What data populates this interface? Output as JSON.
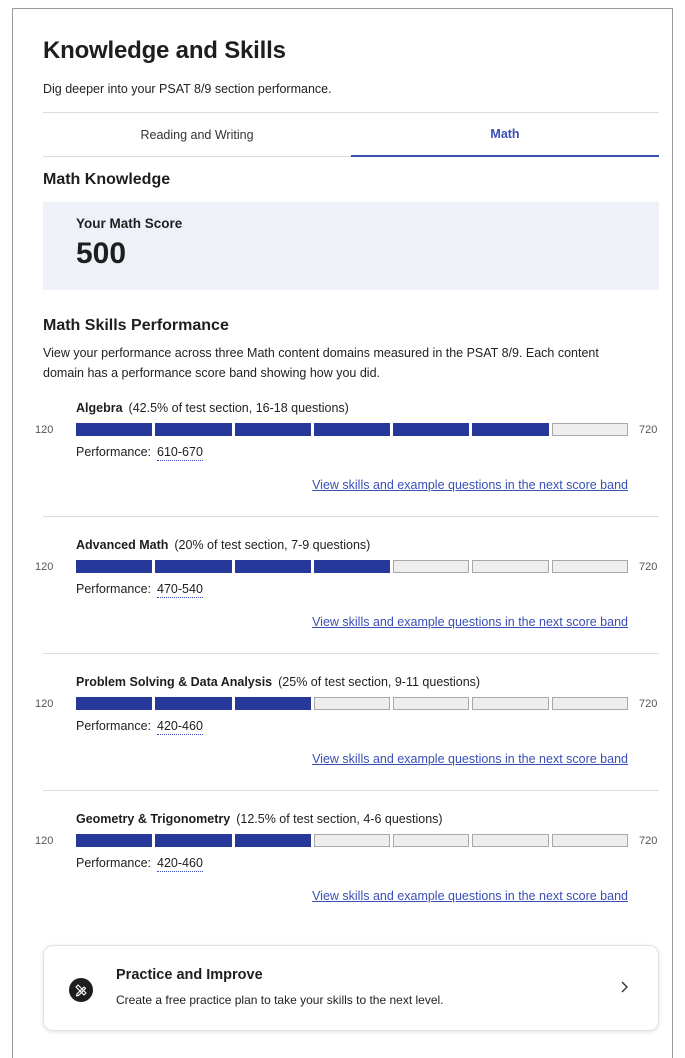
{
  "header": {
    "title": "Knowledge and Skills",
    "subtitle": "Dig deeper into your PSAT 8/9 section performance."
  },
  "tabs": [
    {
      "label": "Reading and Writing",
      "active": false
    },
    {
      "label": "Math",
      "active": true
    }
  ],
  "math_knowledge": {
    "heading": "Math Knowledge",
    "score_label": "Your Math Score",
    "score": "500"
  },
  "skills": {
    "heading": "Math Skills Performance",
    "description": "View your performance across three Math content domains measured in the PSAT 8/9. Each content domain has a performance score band showing how you did.",
    "scale_min": "120",
    "scale_max": "720",
    "performance_label": "Performance:",
    "link_label": "View skills and example questions in the next score band",
    "domains": [
      {
        "name": "Algebra",
        "meta": "(42.5% of test section, 16-18 questions)",
        "band": "610-670",
        "filled_segments": 6,
        "total_segments": 7
      },
      {
        "name": "Advanced Math",
        "meta": "(20% of test section, 7-9 questions)",
        "band": "470-540",
        "filled_segments": 4,
        "total_segments": 7
      },
      {
        "name": "Problem Solving & Data Analysis",
        "meta": "(25% of test section, 9-11 questions)",
        "band": "420-460",
        "filled_segments": 3,
        "total_segments": 7
      },
      {
        "name": "Geometry & Trigonometry",
        "meta": "(12.5% of test section, 4-6 questions)",
        "band": "420-460",
        "filled_segments": 3,
        "total_segments": 7
      }
    ]
  },
  "practice": {
    "title": "Practice and Improve",
    "description": "Create a free practice plan to take your skills to the next level.",
    "icon": "pencil-ruler-icon"
  },
  "colors": {
    "accent": "#3a4fb4",
    "bar_filled": "#26389a",
    "bar_empty": "#eeeeee",
    "score_bg": "#eef1f8"
  }
}
